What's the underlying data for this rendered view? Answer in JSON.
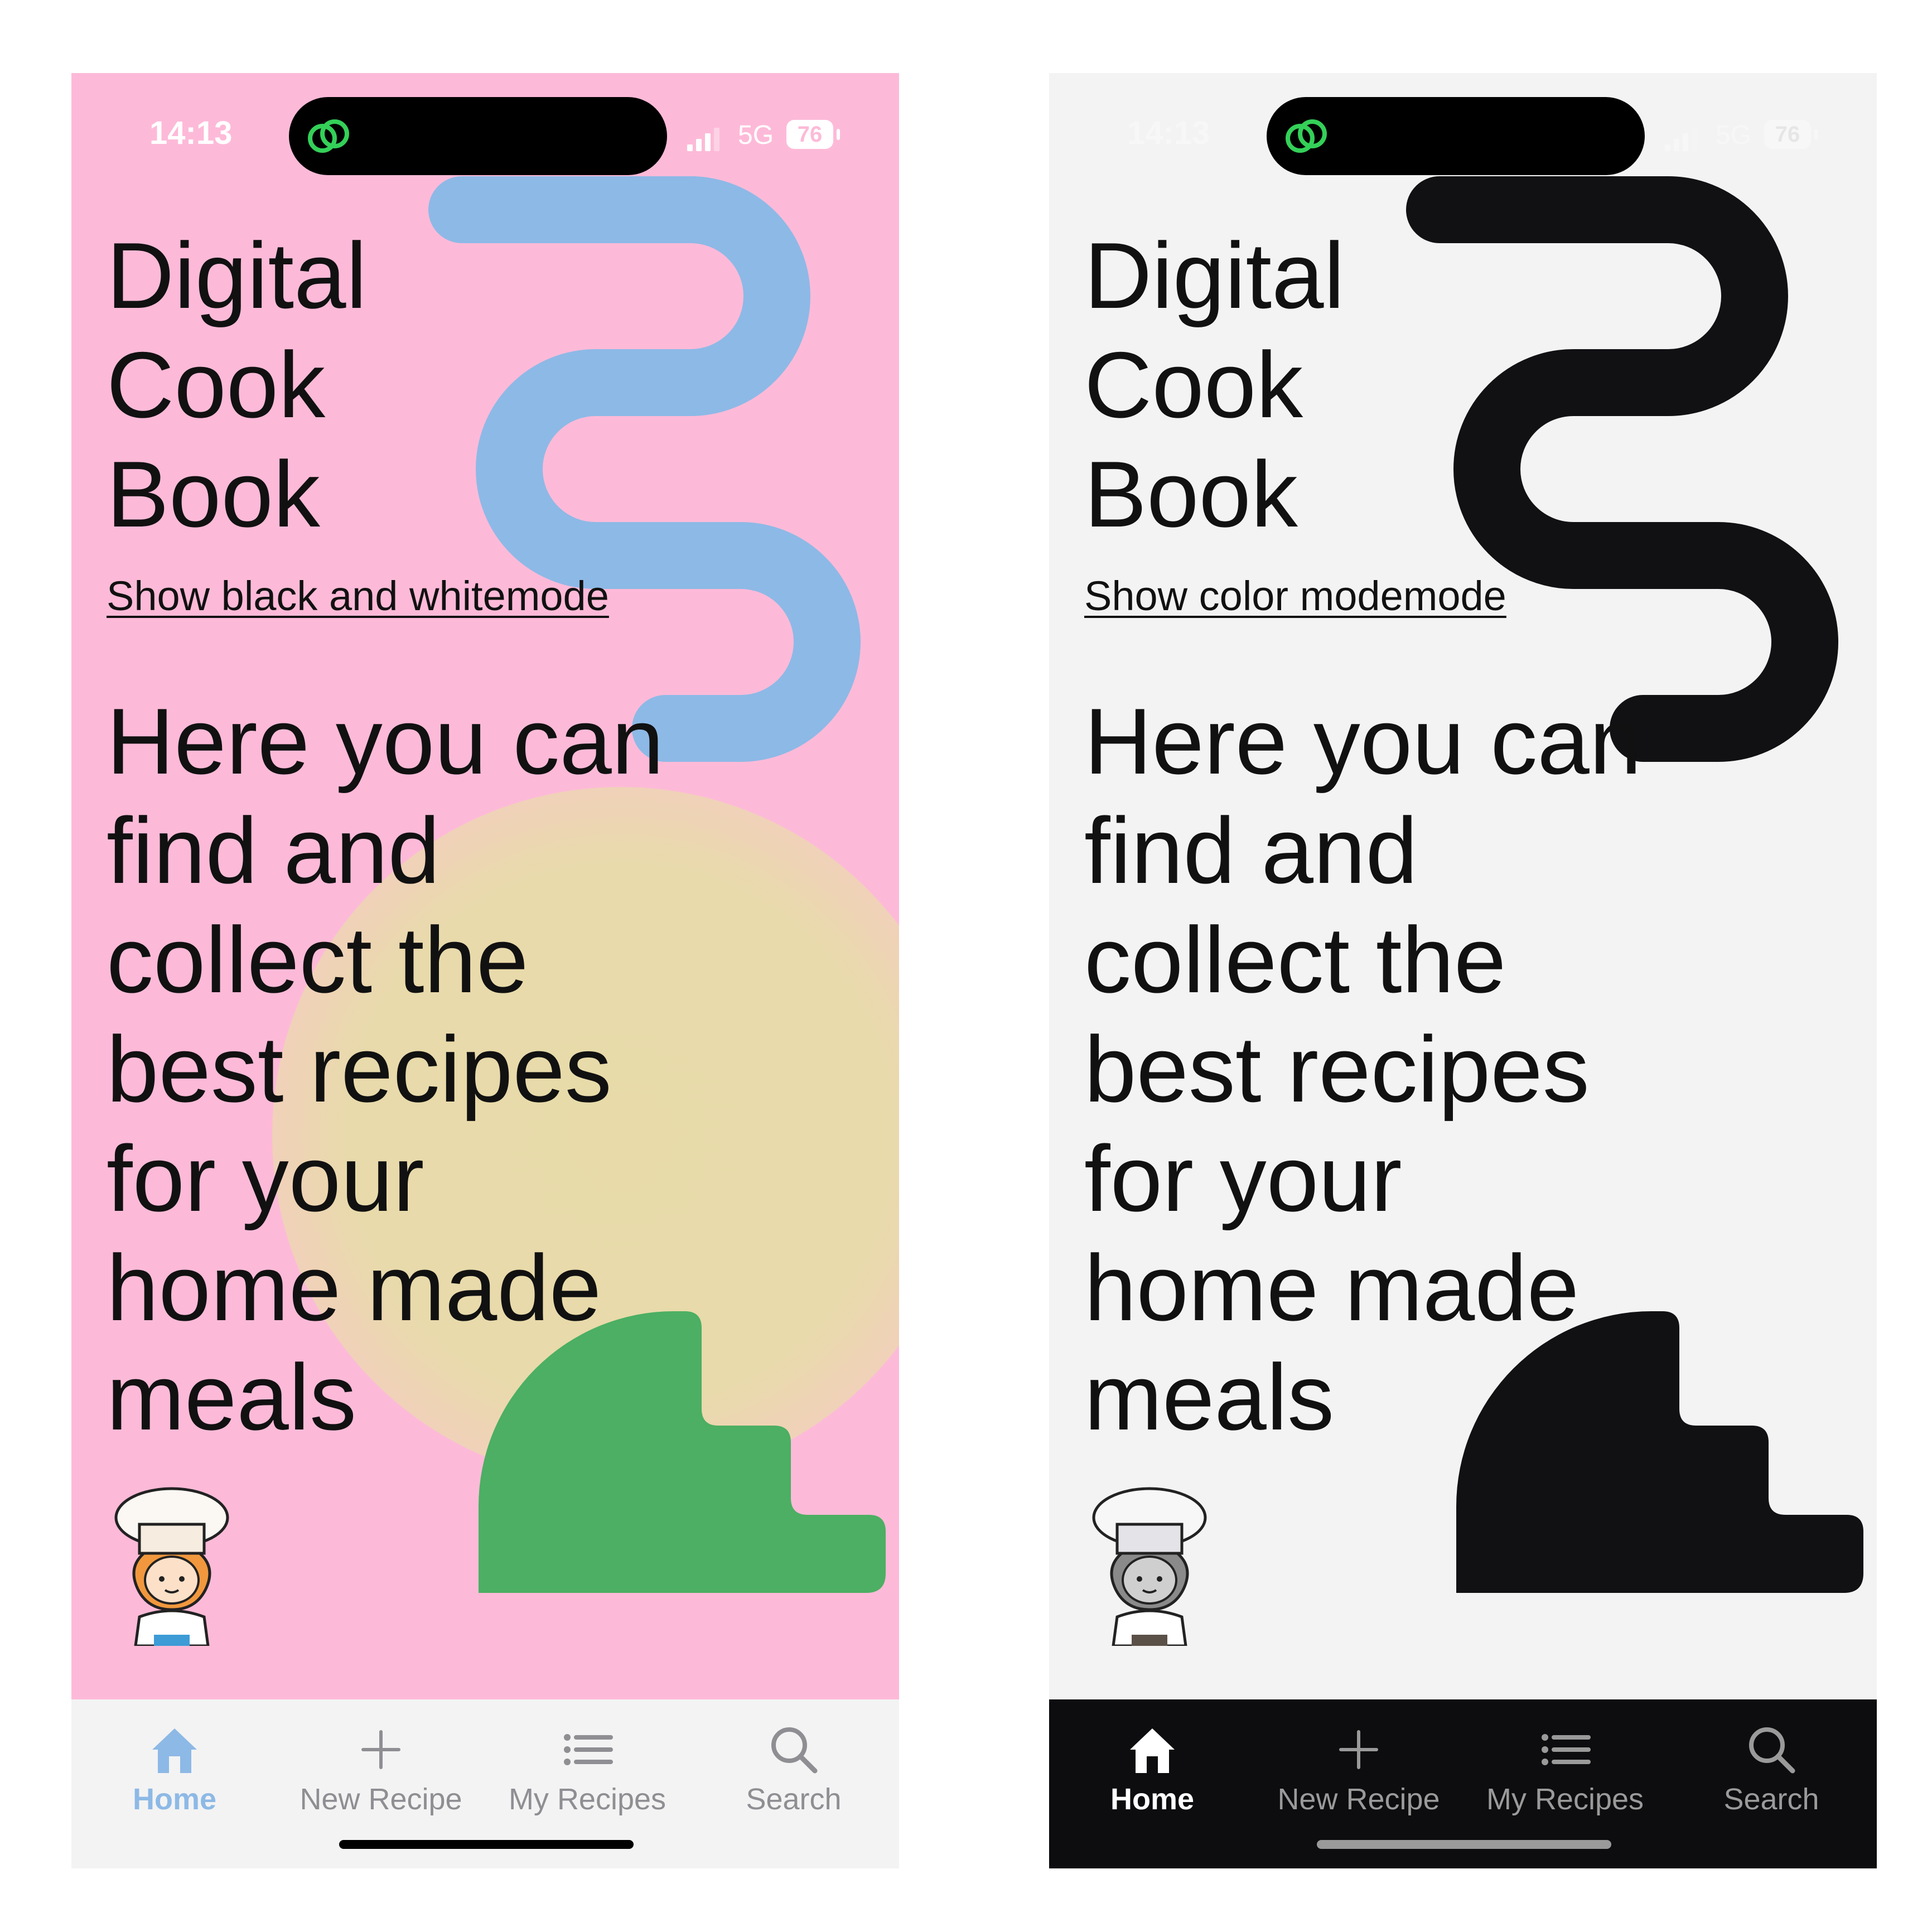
{
  "screens": [
    {
      "id": "color",
      "status": {
        "time": "14:13",
        "network": "5G",
        "battery": "76"
      },
      "title_lines": [
        "Digital",
        "Cook",
        "Book"
      ],
      "mode_link": "Show black and whitemode",
      "tagline_lines": [
        "Here you can",
        "find and",
        "collect the",
        "best recipes",
        "for your",
        "home made",
        "meals"
      ],
      "tabs": [
        {
          "label": "Home",
          "icon": "home-icon",
          "active": true
        },
        {
          "label": "New Recipe",
          "icon": "plus-icon",
          "active": false
        },
        {
          "label": "My Recipes",
          "icon": "list-icon",
          "active": false
        },
        {
          "label": "Search",
          "icon": "search-icon",
          "active": false
        }
      ],
      "colors": {
        "background": "#fdbad8",
        "squiggle": "#8db9e6",
        "blob": "#e8dba9",
        "stairs": "#4caf63",
        "tab_active": "#8db9e6"
      }
    },
    {
      "id": "black-and-white",
      "status": {
        "time": "14:13",
        "network": "5G",
        "battery": "76"
      },
      "title_lines": [
        "Digital",
        "Cook",
        "Book"
      ],
      "mode_link": "Show color modemode",
      "tagline_lines": [
        "Here you can",
        "find and",
        "collect the",
        "best recipes",
        "for your",
        "home made",
        "meals"
      ],
      "tabs": [
        {
          "label": "Home",
          "icon": "home-icon",
          "active": true
        },
        {
          "label": "New Recipe",
          "icon": "plus-icon",
          "active": false
        },
        {
          "label": "My Recipes",
          "icon": "list-icon",
          "active": false
        },
        {
          "label": "Search",
          "icon": "search-icon",
          "active": false
        }
      ],
      "colors": {
        "background": "#f3f3f3",
        "squiggle": "#111114",
        "stairs": "#111114",
        "tab_bar": "#0d0d10",
        "tab_active": "#ffffff"
      }
    }
  ]
}
